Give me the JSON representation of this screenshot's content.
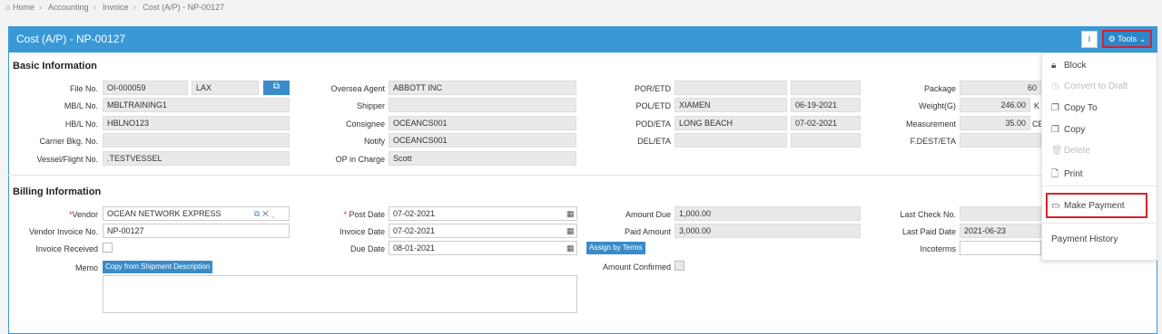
{
  "breadcrumb": [
    "Home",
    "Accounting",
    "Invoice",
    "Cost (A/P) - NP-00127"
  ],
  "header": {
    "title": "Cost (A/P) - NP-00127",
    "info": "i",
    "tools": "Tools"
  },
  "basic": {
    "title": "Basic Information",
    "file_no_label": "File No.",
    "file_no": "OI-000059",
    "file_branch": "LAX",
    "mbl_label": "MB/L No.",
    "mbl": "MBLTRAINING1",
    "hbl_label": "HB/L No.",
    "hbl": "HBLNO123",
    "carrier_label": "Carrier Bkg. No.",
    "carrier": "",
    "vessel_label": "Vessel/Flight No.",
    "vessel": ".TESTVESSEL",
    "oversea_label": "Oversea Agent",
    "oversea": "ABBOTT INC",
    "shipper_label": "Shipper",
    "shipper": "",
    "consignee_label": "Consignee",
    "consignee": "OCEANCS001",
    "notify_label": "Notify",
    "notify": "OCEANCS001",
    "opic_label": "OP in Charge",
    "opic": "Scott",
    "por_label": "POR/ETD",
    "por": "",
    "por_date": "",
    "pol_label": "POL/ETD",
    "pol": "XIAMEN",
    "pol_date": "06-19-2021",
    "pod_label": "POD/ETA",
    "pod": "LONG BEACH",
    "pod_date": "07-02-2021",
    "del_label": "DEL/ETA",
    "del": "",
    "del_date": "",
    "package_label": "Package",
    "package": "60",
    "weight_label": "Weight(G)",
    "weight": "246.00",
    "weight_unit": "K",
    "measure_label": "Measurement",
    "measure": "35.00",
    "measure_unit": "CE",
    "fdest_label": "F.DEST/ETA",
    "fdest": ""
  },
  "billing": {
    "title": "Billing Information",
    "vendor_label": "Vendor",
    "vendor": "OCEAN NETWORK EXPRESS",
    "vinv_label": "Vendor Invoice No.",
    "vinv": "NP-00127",
    "inv_recv_label": "Invoice Received",
    "memo_label": "Memo",
    "copy_ship_btn": "Copy from Shipment Description",
    "post_label": "Post Date",
    "post": "07-02-2021",
    "inv_date_label": "Invoice Date",
    "inv_date": "07-02-2021",
    "due_label": "Due Date",
    "due": "08-01-2021",
    "assign_btn": "Assign by Terms",
    "amt_due_label": "Amount Due",
    "amt_due": "1,000.00",
    "paid_label": "Paid Amount",
    "paid": "3,000.00",
    "amt_conf_label": "Amount Confirmed",
    "last_check_label": "Last Check No.",
    "last_check": "",
    "last_paid_label": "Last Paid Date",
    "last_paid": "2021-06-23",
    "incoterms_label": "Incoterms",
    "incoterms": ""
  },
  "tools_menu": {
    "block": "Block",
    "convert": "Convert to Draft",
    "copy_to": "Copy To",
    "copy": "Copy",
    "delete": "Delete",
    "print": "Print",
    "make_payment": "Make Payment",
    "payment_history": "Payment History"
  },
  "colors": {
    "header": "#3a98d7",
    "highlight": "#d8212c"
  }
}
